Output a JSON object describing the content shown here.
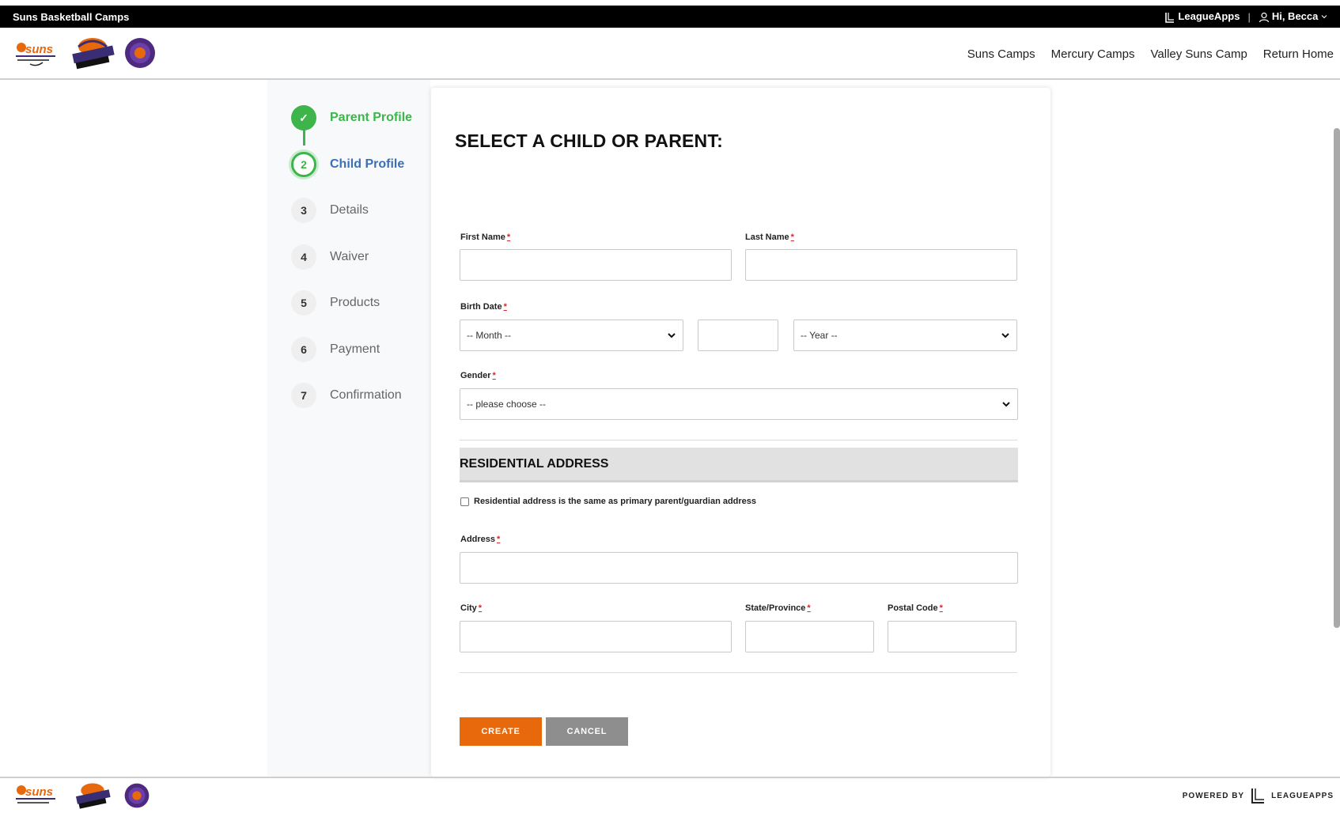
{
  "topbar": {
    "site_title": "Suns Basketball Camps",
    "leagueapps_label": "LeagueApps",
    "separator": "|",
    "user_greeting": "Hi, Becca"
  },
  "nav": {
    "items": [
      "Suns Camps",
      "Mercury Camps",
      "Valley Suns Camp",
      "Return Home"
    ]
  },
  "steps": [
    {
      "number": "✓",
      "label": "Parent Profile",
      "state": "done"
    },
    {
      "number": "2",
      "label": "Child Profile",
      "state": "current"
    },
    {
      "number": "3",
      "label": "Details",
      "state": "upcoming"
    },
    {
      "number": "4",
      "label": "Waiver",
      "state": "upcoming"
    },
    {
      "number": "5",
      "label": "Products",
      "state": "upcoming"
    },
    {
      "number": "6",
      "label": "Payment",
      "state": "upcoming"
    },
    {
      "number": "7",
      "label": "Confirmation",
      "state": "upcoming"
    }
  ],
  "form": {
    "title": "SELECT A CHILD OR PARENT:",
    "required_mark": "*",
    "first_name_label": "First Name",
    "first_name_value": "",
    "last_name_label": "Last Name",
    "last_name_value": "",
    "birth_date_label": "Birth Date",
    "month_selected": "-- Month --",
    "day_value": "",
    "year_selected": "-- Year --",
    "gender_label": "Gender",
    "gender_selected": "-- please choose --",
    "residential_heading": "RESIDENTIAL ADDRESS",
    "same_address_label": "Residential address is the same as primary parent/guardian address",
    "same_address_checked": false,
    "address_label": "Address",
    "address_value": "",
    "city_label": "City",
    "city_value": "",
    "state_label": "State/Province",
    "state_value": "",
    "postal_label": "Postal Code",
    "postal_value": "",
    "create_label": "CREATE",
    "cancel_label": "CANCEL"
  },
  "footer": {
    "powered_by": "POWERED BY",
    "leagueapps_mark": "LEAGUEAPPS"
  },
  "colors": {
    "accent_green": "#3db54a",
    "current_blue": "#3b6fb6",
    "create_orange": "#e8680c",
    "cancel_gray": "#8e8e8e",
    "required_red": "#d9262a"
  }
}
